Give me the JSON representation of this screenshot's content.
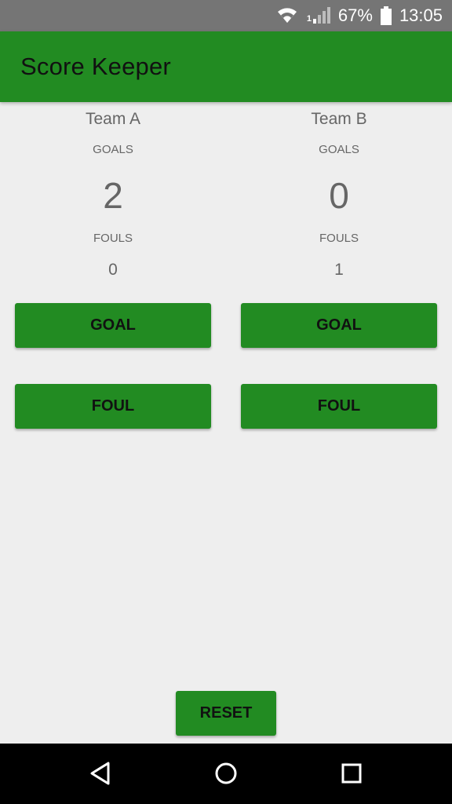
{
  "status_bar": {
    "battery_percent": "67%",
    "time": "13:05",
    "signal_label": "1"
  },
  "app_bar": {
    "title": "Score Keeper"
  },
  "team_a": {
    "name": "Team A",
    "goals_label": "GOALS",
    "goals": "2",
    "fouls_label": "FOULS",
    "fouls": "0",
    "goal_button": "GOAL",
    "foul_button": "FOUL"
  },
  "team_b": {
    "name": "Team B",
    "goals_label": "GOALS",
    "goals": "0",
    "fouls_label": "FOULS",
    "fouls": "1",
    "goal_button": "GOAL",
    "foul_button": "FOUL"
  },
  "reset_button": "RESET",
  "colors": {
    "primary": "#228b22",
    "status_bar": "#757575",
    "background": "#eeeeee",
    "text_secondary": "#666666"
  },
  "icons": {
    "wifi": "wifi-icon",
    "signal": "signal-icon",
    "battery": "battery-icon",
    "back": "back-icon",
    "home": "home-icon",
    "recents": "recents-icon"
  }
}
